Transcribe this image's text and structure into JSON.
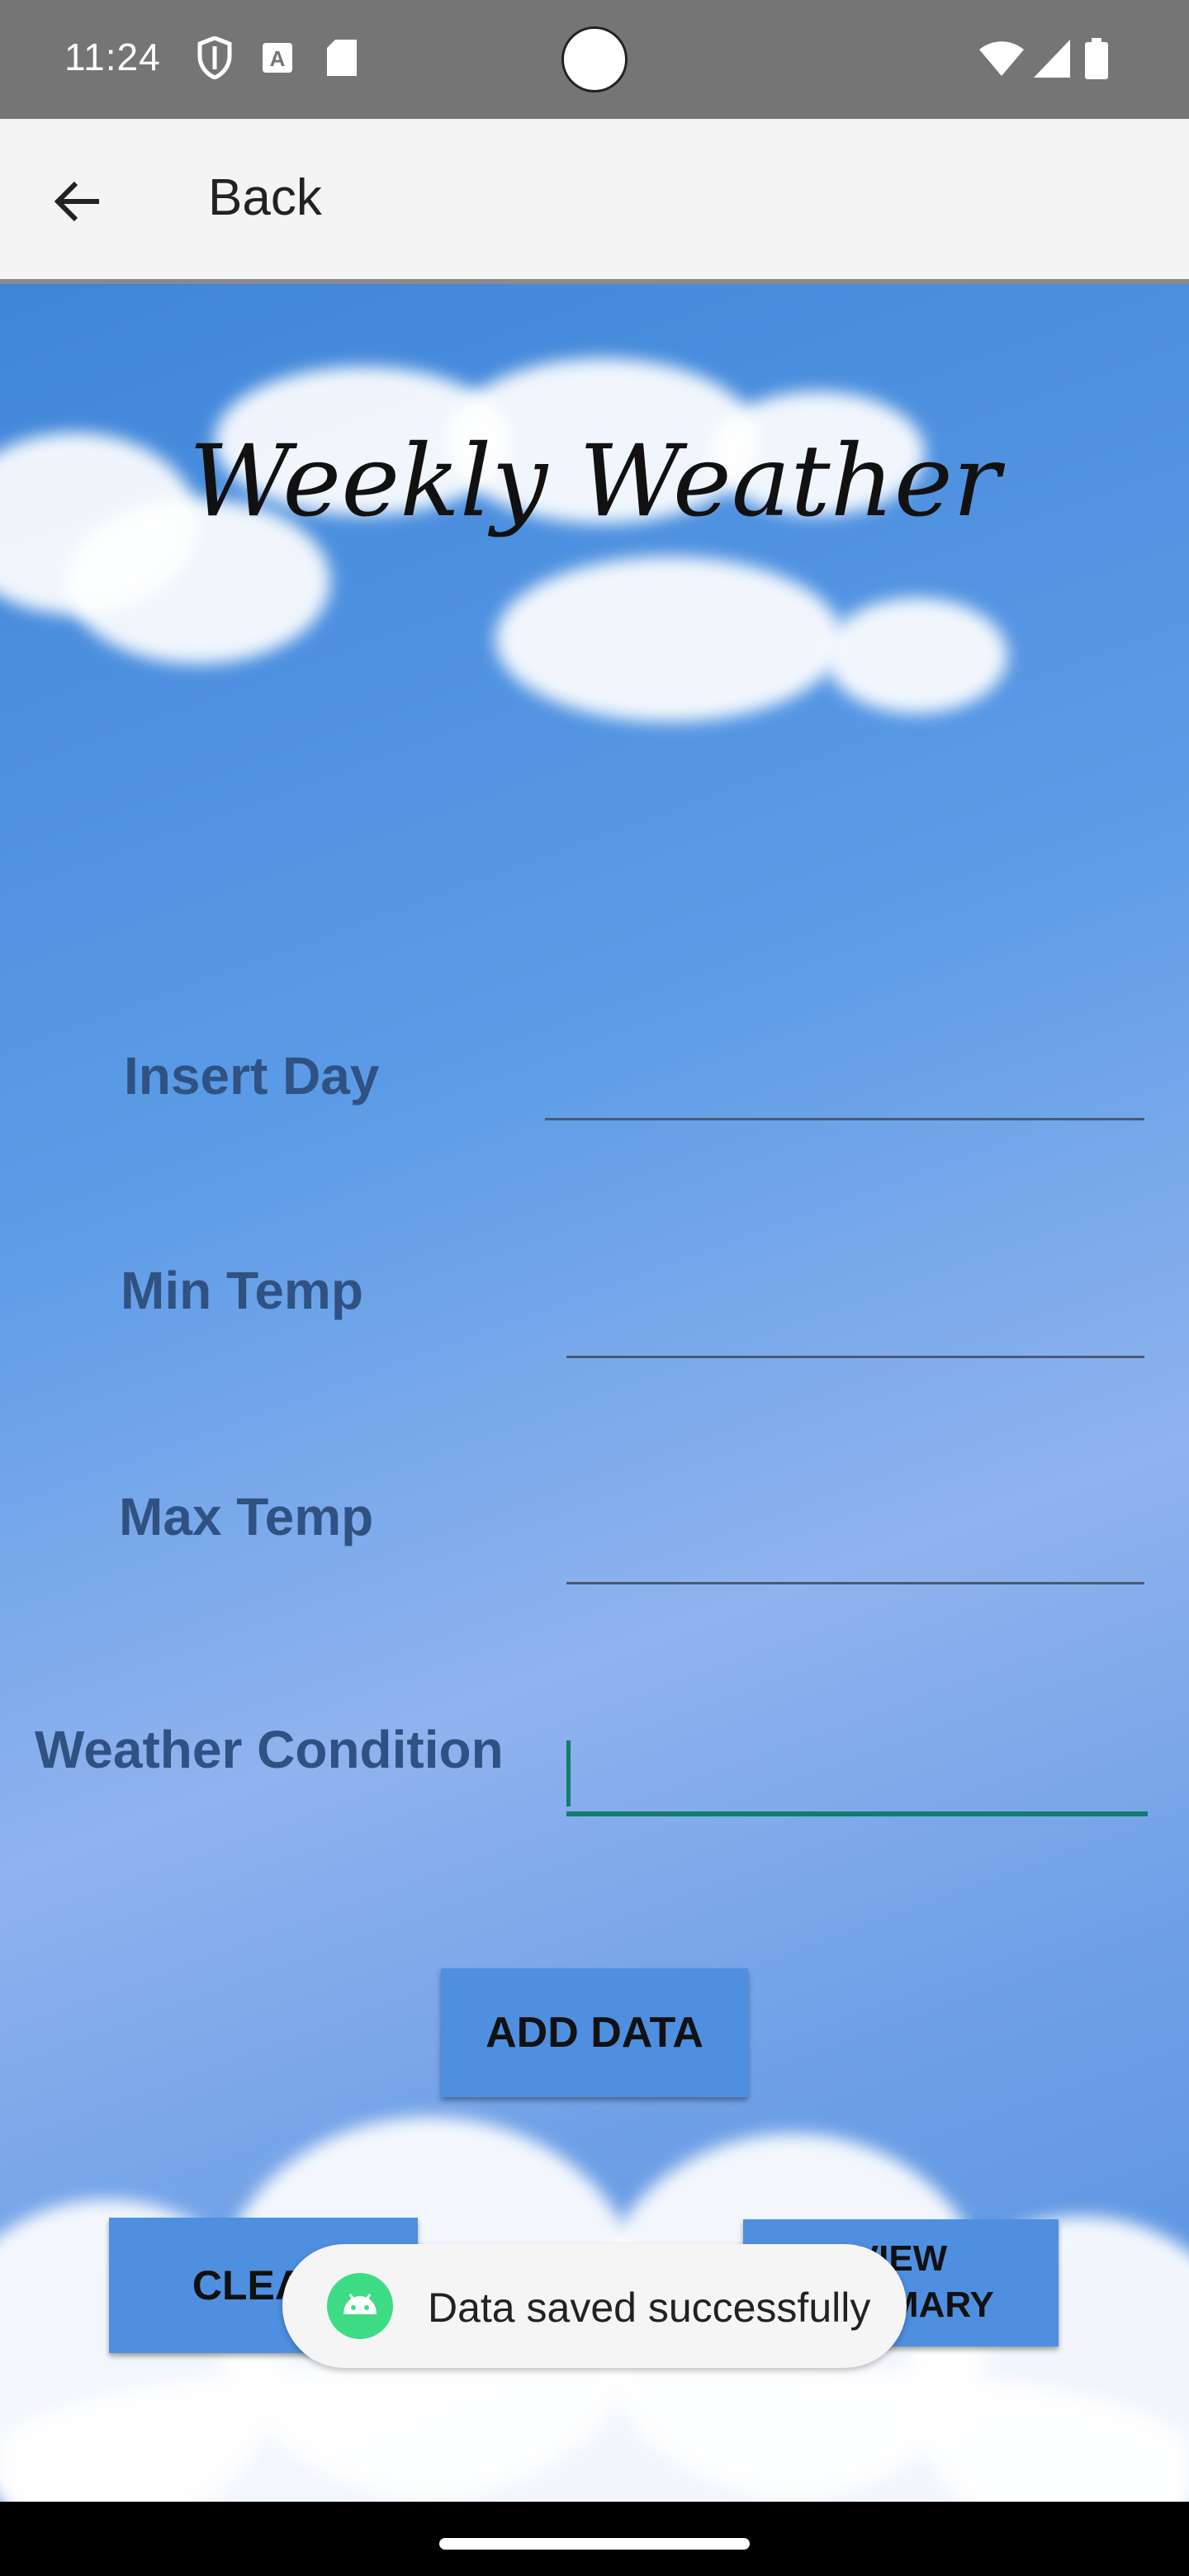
{
  "status_bar": {
    "time": "11:24",
    "left_icons": [
      "shield-icon",
      "a-box-icon",
      "sd-card-icon"
    ],
    "right_icons": [
      "wifi-icon",
      "signal-icon",
      "battery-icon"
    ]
  },
  "app_bar": {
    "back_icon": "arrow-back-icon",
    "title": "Back"
  },
  "page": {
    "headline": "Weekly Weather",
    "fields": {
      "day_label": "Insert Day",
      "day_value": "",
      "min_label": "Min Temp",
      "min_value": "",
      "max_label": "Max Temp",
      "max_value": "",
      "condition_label": "Weather Condition",
      "condition_value": ""
    },
    "buttons": {
      "add": "ADD DATA",
      "clear": "CLEAR",
      "summary_line1": "VIEW",
      "summary_line2": "SUMMARY"
    }
  },
  "toast": {
    "icon": "android-icon",
    "message": "Data saved successfully"
  },
  "colors": {
    "accent": "#127d6c",
    "button": "#4f8fe0",
    "label": "#2f5282"
  }
}
